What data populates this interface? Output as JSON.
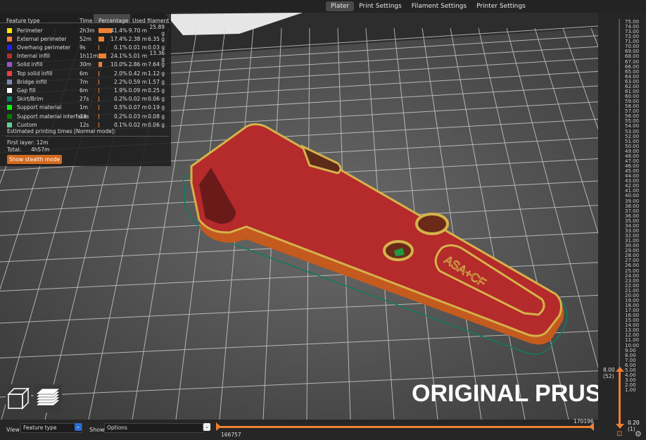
{
  "tabs": [
    {
      "label": "Plater",
      "active": true
    },
    {
      "label": "Print Settings",
      "active": false
    },
    {
      "label": "Filament Settings",
      "active": false
    },
    {
      "label": "Printer Settings",
      "active": false
    }
  ],
  "legend": {
    "headers": {
      "feature": "Feature type",
      "time": "Time",
      "percentage": "Percentage",
      "used": "Used filament"
    },
    "rows": [
      {
        "label": "Perimeter",
        "color": "#ffe500",
        "time": "2h3m",
        "pct": "41.4%",
        "m": "9.70 m",
        "g": "25.89 g",
        "frac": 0.414
      },
      {
        "label": "External perimeter",
        "color": "#ff7d38",
        "time": "52m",
        "pct": "17.4%",
        "m": "2.38 m",
        "g": "6.35 g",
        "frac": 0.174
      },
      {
        "label": "Overhang perimeter",
        "color": "#1f1fff",
        "time": "9s",
        "pct": "0.1%",
        "m": "0.01 m",
        "g": "0.03 g",
        "frac": 0.001
      },
      {
        "label": "Internal infill",
        "color": "#b03029",
        "time": "1h11m",
        "pct": "24.1%",
        "m": "5.01 m",
        "g": "13.36 g",
        "frac": 0.241
      },
      {
        "label": "Solid infill",
        "color": "#9654cc",
        "time": "30m",
        "pct": "10.0%",
        "m": "2.86 m",
        "g": "7.64 g",
        "frac": 0.1
      },
      {
        "label": "Top solid infill",
        "color": "#f04040",
        "time": "6m",
        "pct": "2.0%",
        "m": "0.42 m",
        "g": "1.12 g",
        "frac": 0.02
      },
      {
        "label": "Bridge infill",
        "color": "#7d87b3",
        "time": "7m",
        "pct": "2.2%",
        "m": "0.59 m",
        "g": "1.57 g",
        "frac": 0.022
      },
      {
        "label": "Gap fill",
        "color": "#ffffff",
        "time": "6m",
        "pct": "1.9%",
        "m": "0.09 m",
        "g": "0.25 g",
        "frac": 0.019
      },
      {
        "label": "Skirt/Brim",
        "color": "#00876e",
        "time": "27s",
        "pct": "0.2%",
        "m": "0.02 m",
        "g": "0.06 g",
        "frac": 0.002
      },
      {
        "label": "Support material",
        "color": "#00ff00",
        "time": "1m",
        "pct": "0.5%",
        "m": "0.07 m",
        "g": "0.19 g",
        "frac": 0.005
      },
      {
        "label": "Support material interface",
        "color": "#008000",
        "time": "33s",
        "pct": "0.2%",
        "m": "0.03 m",
        "g": "0.08 g",
        "frac": 0.002
      },
      {
        "label": "Custom",
        "color": "#5ed194",
        "time": "12s",
        "pct": "0.1%",
        "m": "0.02 m",
        "g": "0.06 g",
        "frac": 0.001
      }
    ],
    "estimated": "Estimated printing times [Normal mode]:",
    "first_layer": "First layer: 12m",
    "total_label": "Total:",
    "total_value": "4h57m",
    "stealth_button": "Show stealth mode"
  },
  "bed_text": "ORIGINAL PRUS",
  "part_text": "ASA+CF",
  "bottom": {
    "view_label": "View",
    "view_value": "Feature type",
    "show_label": "Show",
    "show_value": "Options",
    "left_value": "166757",
    "right_value": "170196"
  },
  "ruler": {
    "ticks": [
      "75.00",
      "74.00",
      "73.00",
      "72.00",
      "71.00",
      "70.00",
      "69.00",
      "68.00",
      "67.00",
      "66.00",
      "65.00",
      "64.00",
      "63.00",
      "62.00",
      "61.00",
      "60.00",
      "59.00",
      "58.00",
      "57.00",
      "56.00",
      "55.00",
      "54.00",
      "53.00",
      "52.00",
      "51.00",
      "50.00",
      "49.00",
      "48.00",
      "47.00",
      "46.00",
      "45.00",
      "44.00",
      "43.00",
      "42.00",
      "41.00",
      "40.00",
      "39.00",
      "38.00",
      "37.00",
      "36.00",
      "35.00",
      "34.00",
      "33.00",
      "32.00",
      "31.00",
      "30.00",
      "29.00",
      "28.00",
      "27.00",
      "26.00",
      "25.00",
      "24.00",
      "23.00",
      "22.00",
      "21.00",
      "20.00",
      "19.00",
      "18.00",
      "17.00",
      "16.00",
      "15.00",
      "14.00",
      "13.00",
      "12.00",
      "11.00",
      "10.00",
      "9.00",
      "8.00",
      "7.00",
      "6.00",
      "5.00",
      "4.00",
      "3.00",
      "2.00",
      "1.00"
    ],
    "upper_value": "8.00",
    "upper_layer": "(52)",
    "lower_value": "0.20",
    "lower_layer": "(1)"
  }
}
